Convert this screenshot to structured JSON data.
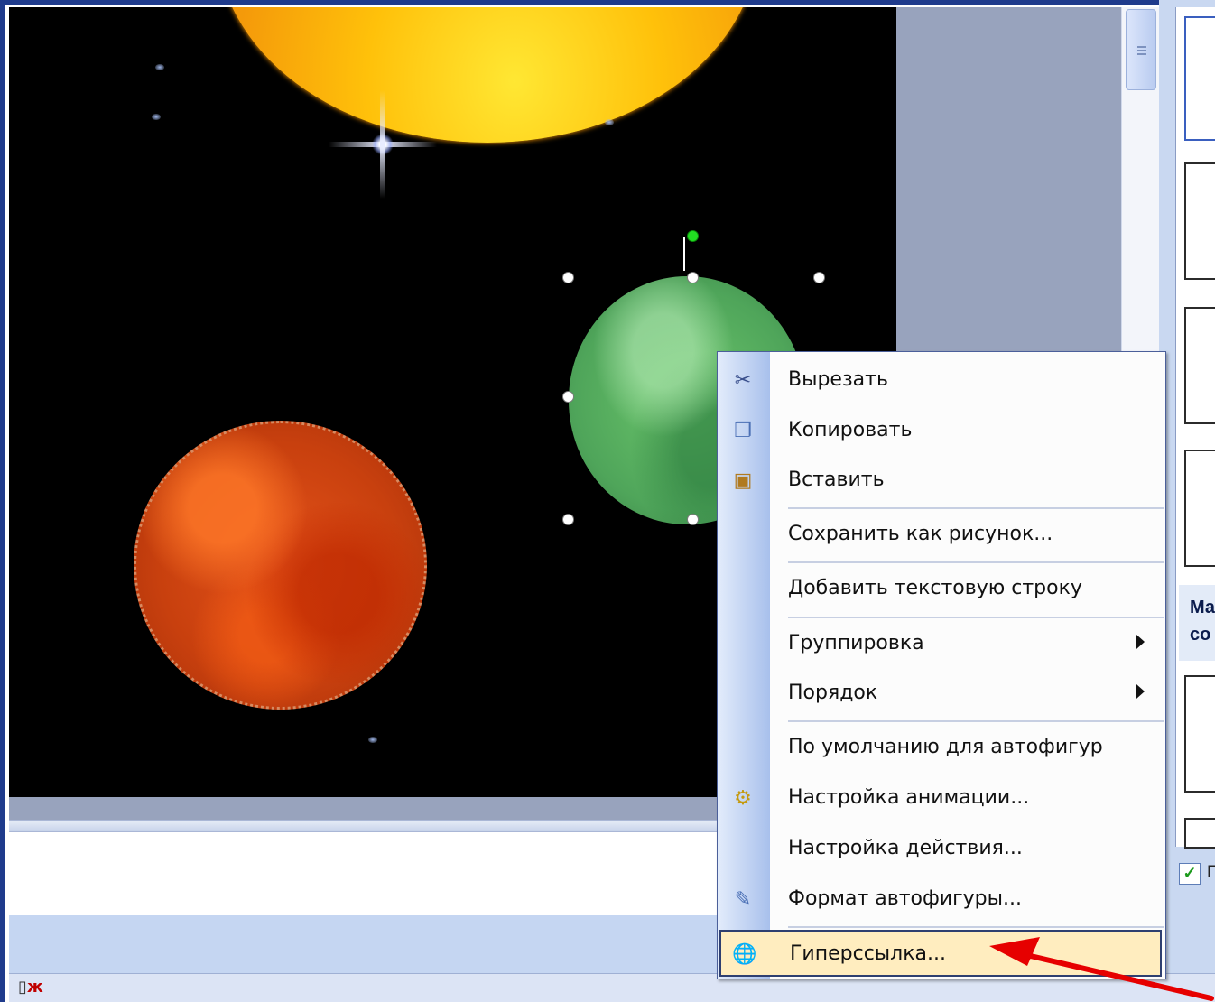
{
  "context_menu": {
    "items": [
      {
        "label": "Вырезать",
        "icon": "scissors-icon",
        "icon_glyph": "✂"
      },
      {
        "label": "Копировать",
        "icon": "copy-icon",
        "icon_glyph": "❐"
      },
      {
        "label": "Вставить",
        "icon": "paste-icon",
        "icon_glyph": "📋"
      },
      {
        "label": "Сохранить как рисунок...",
        "icon": ""
      },
      {
        "label": "Добавить текстовую строку",
        "icon": ""
      },
      {
        "label": "Группировка",
        "icon": "",
        "submenu": true
      },
      {
        "label": "Порядок",
        "icon": "",
        "submenu": true
      },
      {
        "label": "По умолчанию для автофигур",
        "icon": ""
      },
      {
        "label": "Настройка анимации...",
        "icon": "custom-animation-icon",
        "icon_glyph": "⚙"
      },
      {
        "label": "Настройка действия...",
        "icon": ""
      },
      {
        "label": "Формат автофигуры...",
        "icon": "format-shape-icon",
        "icon_glyph": "🖌"
      },
      {
        "label": "Гиперссылка...",
        "icon": "hyperlink-globe-icon",
        "icon_glyph": "🌐",
        "highlighted": true
      }
    ]
  },
  "task_pane": {
    "section_text_1": "Ма",
    "section_text_2": "со",
    "checkbox_label": "П",
    "checkbox_checked": true
  },
  "status_bar": {
    "spellcheck_icon": "spellcheck-icon"
  },
  "colors": {
    "menu_highlight": "#ffedbf",
    "arrow": "#e60000",
    "slide_background": "#000000"
  }
}
